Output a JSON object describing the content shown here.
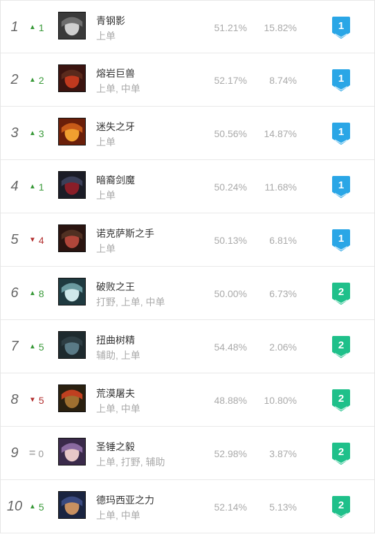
{
  "colors": {
    "tier1": "#2aa6e6",
    "tier2": "#1fc08a",
    "up": "#3a9a3a",
    "down": "#b33030"
  },
  "rows": [
    {
      "rank": "1",
      "dir": "up",
      "change": "1",
      "name": "青钢影",
      "lanes": "上单",
      "winrate": "51.21%",
      "pickrate": "15.82%",
      "tier": "1",
      "tier_color": "#2aa6e6",
      "portrait": [
        "#3a3a3a",
        "#cfcfcf",
        "#6e6e6e"
      ]
    },
    {
      "rank": "2",
      "dir": "up",
      "change": "2",
      "name": "熔岩巨兽",
      "lanes": "上单, 中单",
      "winrate": "52.17%",
      "pickrate": "8.74%",
      "tier": "1",
      "tier_color": "#2aa6e6",
      "portrait": [
        "#3b1410",
        "#c0391e",
        "#5a2a1c"
      ]
    },
    {
      "rank": "3",
      "dir": "up",
      "change": "3",
      "name": "迷失之牙",
      "lanes": "上单",
      "winrate": "50.56%",
      "pickrate": "14.87%",
      "tier": "1",
      "tier_color": "#2aa6e6",
      "portrait": [
        "#6a1f0a",
        "#f0a030",
        "#c75a18"
      ]
    },
    {
      "rank": "4",
      "dir": "up",
      "change": "1",
      "name": "暗裔剑魔",
      "lanes": "上单",
      "winrate": "50.24%",
      "pickrate": "11.68%",
      "tier": "1",
      "tier_color": "#2aa6e6",
      "portrait": [
        "#1b1c26",
        "#8a1e28",
        "#3b3f58"
      ]
    },
    {
      "rank": "5",
      "dir": "down",
      "change": "4",
      "name": "诺克萨斯之手",
      "lanes": "上单",
      "winrate": "50.13%",
      "pickrate": "6.81%",
      "tier": "1",
      "tier_color": "#2aa6e6",
      "portrait": [
        "#2a1410",
        "#b0463a",
        "#503022"
      ]
    },
    {
      "rank": "6",
      "dir": "up",
      "change": "8",
      "name": "破败之王",
      "lanes": "打野, 上单, 中单",
      "winrate": "50.00%",
      "pickrate": "6.73%",
      "tier": "2",
      "tier_color": "#1fc08a",
      "portrait": [
        "#1f3a40",
        "#cfe8ea",
        "#6a9aa0"
      ]
    },
    {
      "rank": "7",
      "dir": "up",
      "change": "5",
      "name": "扭曲树精",
      "lanes": "辅助, 上单",
      "winrate": "54.48%",
      "pickrate": "2.06%",
      "tier": "2",
      "tier_color": "#1fc08a",
      "portrait": [
        "#1e2a2e",
        "#5a7a86",
        "#2e3e44"
      ]
    },
    {
      "rank": "8",
      "dir": "down",
      "change": "5",
      "name": "荒漠屠夫",
      "lanes": "上单, 中单",
      "winrate": "48.88%",
      "pickrate": "10.80%",
      "tier": "2",
      "tier_color": "#1fc08a",
      "portrait": [
        "#2a2010",
        "#a07030",
        "#c04020"
      ]
    },
    {
      "rank": "9",
      "dir": "same",
      "change": "0",
      "name": "圣锤之毅",
      "lanes": "上单, 打野, 辅助",
      "winrate": "52.98%",
      "pickrate": "3.87%",
      "tier": "2",
      "tier_color": "#1fc08a",
      "portrait": [
        "#3a2a4a",
        "#e8c8c8",
        "#8a6aa0"
      ]
    },
    {
      "rank": "10",
      "dir": "up",
      "change": "5",
      "name": "德玛西亚之力",
      "lanes": "上单, 中单",
      "winrate": "52.14%",
      "pickrate": "5.13%",
      "tier": "2",
      "tier_color": "#1fc08a",
      "portrait": [
        "#1a2440",
        "#c89060",
        "#3a4a80"
      ]
    }
  ]
}
